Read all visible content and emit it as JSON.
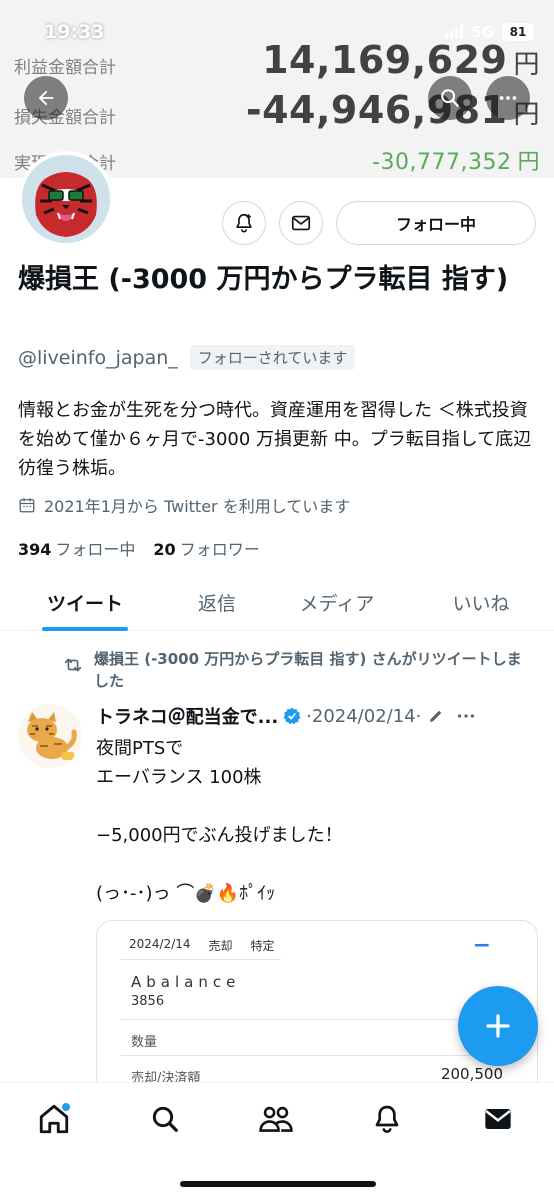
{
  "status_bar": {
    "time": "19:33",
    "network": "5G",
    "battery": "81"
  },
  "banner": {
    "rows": [
      {
        "label": "利益金額合計",
        "value": "14,169,629",
        "unit": "円"
      },
      {
        "label": "損失金額合計",
        "value": "-44,946,981",
        "unit": "円"
      },
      {
        "label": "実現損益合計",
        "value": "-30,777,352",
        "unit": "円"
      }
    ]
  },
  "profile": {
    "follow_button": "フォロー中",
    "name": "爆損王 (-3000 万円からプラ転目 指す)",
    "handle": "@liveinfo_japan_",
    "follows_you": "フォローされています",
    "bio": "情報とお金が生死を分つ時代。資産運用を習得した ＜株式投資を始めて僅か６ヶ月で-3000 万損更新 中。プラ転目指して底辺彷徨う株垢。",
    "joined": "2021年1月から Twitter を利用しています",
    "following_count": "394",
    "following_label": "フォロー中",
    "followers_count": "20",
    "followers_label": "フォロワー"
  },
  "tabs": [
    {
      "label": "ツイート",
      "active": true
    },
    {
      "label": "返信",
      "active": false
    },
    {
      "label": "メディア",
      "active": false
    },
    {
      "label": "いいね",
      "active": false
    }
  ],
  "tweet": {
    "retweet_text": "爆損王 (-3000 万円からプラ転目 指す) さんがリツイートしました",
    "author": "トラネコ＠配当金で...",
    "date": "·2024/02/14·",
    "text": "夜間PTSで\nエーバランス 100株\n\n−5,000円でぶん投げました！\n\n(っ･-･)っ ⌒💣🔥ﾎﾟｲｯ",
    "card": {
      "date": "2024/2/14",
      "type": "売却",
      "account": "特定",
      "stock": "Abalance",
      "code": "3856",
      "qty_label": "数量",
      "amount_label": "売却/決済額",
      "amount_value": "200,500"
    }
  },
  "colors": {
    "accent": "#1d9bf0",
    "profit_green": "#3f9b3f"
  }
}
